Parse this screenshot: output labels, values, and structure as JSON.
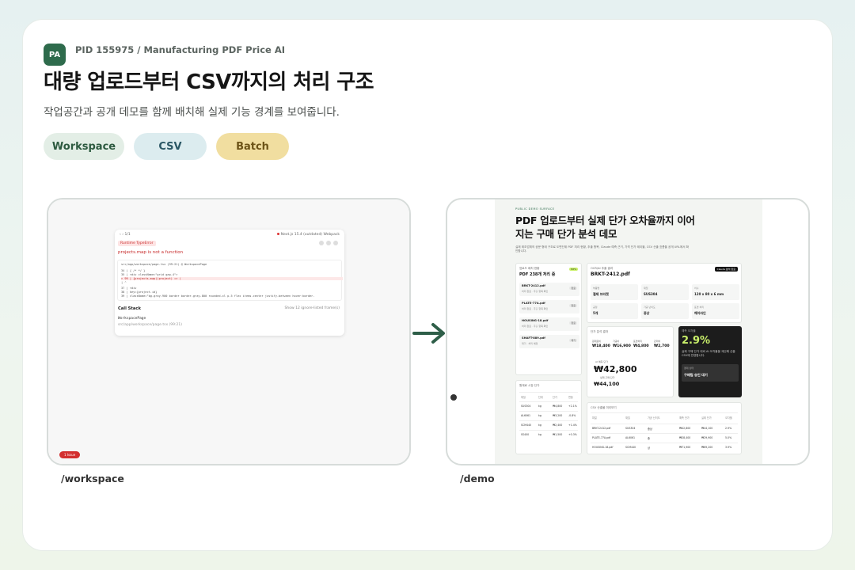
{
  "header": {
    "badge": "PA",
    "pid": "PID 155975 / Manufacturing PDF Price AI",
    "title": "대량 업로드부터 CSV까지의 처리 구조",
    "subtitle": "작업공간과 공개 데모를 함께 배치해 실제 기능 경계를 보여줍니다."
  },
  "chips": [
    "Workspace",
    "CSV",
    "Batch"
  ],
  "captions": {
    "left": "/workspace",
    "right": "/demo"
  },
  "colors": {
    "accent": "#2e6b4c",
    "error": "#d32f2f",
    "lime": "#c9ef6a"
  },
  "workspace": {
    "nav": "‹ › 1/1",
    "next_version": "Next.js 15.4 (outdated) Webpack",
    "error_kind": "Runtime TypeError",
    "error_message": "projects.map is not a function",
    "file_path": "src/app/workspace/page.tsx (99:21) @ WorkspacePage",
    "code_lines": [
      "34 |       { /* */ }",
      "35 |     <div className=\"grid gap-4\">",
      "> 99 |       {projects.map((project) => (",
      "   |                 ^",
      "37 |       <div",
      "38 |         key={project.id}",
      "39 |         className=\"bg-gray-900 border border-gray-800 rounded-xl p-5 flex items-center justify-between hover:border-"
    ],
    "call_stack": "Call Stack",
    "show_frames": "Show 12 ignore-listed frame(s)",
    "frame_fn": "WorkspacePage",
    "frame_path": "src/app/workspace/page.tsx (99:21)",
    "issue_badge": "1 Issue"
  },
  "demo": {
    "eyebrow": "PUBLIC DEMO SURFACE",
    "headline": "PDF 업로드부터 실제 단가 오차율까지 이어지는 구매 단가 분석 데모",
    "lead": "실제 제조업체의 공문 형태 구조로 도면단위 PDF 처리 현황, 추출 항목, Claude 예측 근거, 가격 단가 테이블, CSV 산출 흐름을 공개 URL에서 확인합니다.",
    "batch_label": "업로드 배치 현황",
    "batch_title": "PDF 238개 처리 중",
    "batch_tag": "82%",
    "files": [
      {
        "name": "BRKT-2412.pdf",
        "sub": "처리 완료 · 추출 항목 확인",
        "badge": "완료"
      },
      {
        "name": "PLATE-77A.pdf",
        "sub": "처리 완료 · 추출 항목 확인",
        "badge": "완료"
      },
      {
        "name": "HOUSING-18.pdf",
        "sub": "처리 완료 · 추출 항목 확인",
        "badge": "완료"
      },
      {
        "name": "SHAFT-889.pdf",
        "sub": "대기 · 처리 예정",
        "badge": "대기"
      }
    ],
    "ocr_label": "OCR/AI 추출 결과",
    "ocr_title": "BRKT-2412.pdf",
    "claude_btn": "Claude 분석 완료",
    "fields": [
      {
        "label": "부품명",
        "value": "철제 브라켓"
      },
      {
        "label": "재질",
        "value": "SUS304"
      },
      {
        "label": "치수",
        "value": "120 x 80 x 6 mm"
      },
      {
        "label": "공정",
        "value": "5개"
      },
      {
        "label": "가공 난이도",
        "value": "중상"
      },
      {
        "label": "표면 처리",
        "value": "해어라인"
      }
    ],
    "price_label": "단가 분석 결과",
    "prices": [
      "₩18,400",
      "₩16,900",
      "₩4,800",
      "₩2,700"
    ],
    "price_labels": [
      "원재료비",
      "가공비",
      "표면처리",
      "관리비"
    ],
    "ai_label": "AI 예측 단가",
    "ai_price": "₩42,800",
    "actual_label": "실제 구매 단가",
    "actual_price": "₩44,100",
    "error_label": "예측 오차율",
    "error_rate": "2.9%",
    "error_desc": "실제 구매 단가 대비 AI 오차율을 계산해 산출 CSV에 반영합니다.",
    "approval_label": "결재 상태",
    "approval": "구매팀 승인 대기",
    "material_label": "원재료 시장 단가",
    "material_headers": [
      "재질",
      "단위",
      "단가",
      "변동"
    ],
    "material_rows": [
      [
        "SUS304",
        "kg",
        "₩4,800",
        "+2.1%"
      ],
      [
        "AL6061",
        "kg",
        "₩3,200",
        "-0.8%"
      ],
      [
        "SCM440",
        "kg",
        "₩2,400",
        "+1.4%"
      ],
      [
        "SS400",
        "kg",
        "₩1,500",
        "+0.3%"
      ]
    ],
    "csv_label": "CSV 산출물 미리보기",
    "csv_headers": [
      "파일",
      "재질",
      "가공 난이도",
      "예측 단가",
      "실제 단가",
      "오차율"
    ],
    "csv_rows": [
      [
        "BRKT-2412.pdf",
        "SUS304",
        "중상",
        "₩42,800",
        "₩44,100",
        "2.9%"
      ],
      [
        "PLATE-77A.pdf",
        "AL6061",
        "중",
        "₩28,400",
        "₩29,900",
        "5.0%"
      ],
      [
        "HOUSING-18.pdf",
        "SCM440",
        "상",
        "₩71,900",
        "₩69,200",
        "3.9%"
      ]
    ]
  }
}
